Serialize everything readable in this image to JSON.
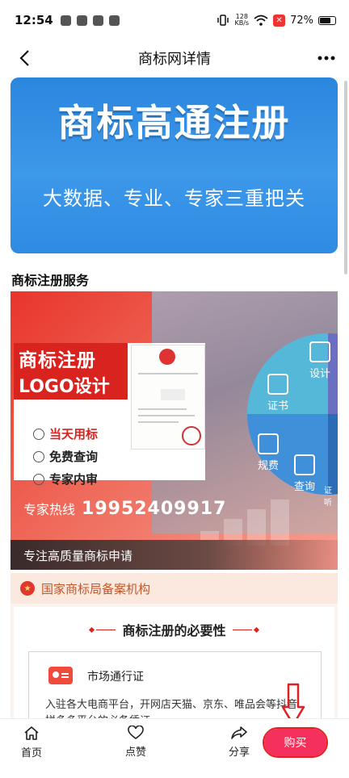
{
  "status_bar": {
    "time": "12:54",
    "speed_value": "128",
    "speed_unit": "KB/s",
    "battery": "72%"
  },
  "nav": {
    "title": "商标网详情"
  },
  "hero": {
    "title": "商标高通注册",
    "subtitle": "大数据、专业、专家三重把关"
  },
  "section_title": "商标注册服务",
  "promo": {
    "main_title": "商标注册",
    "logo_design": "LOGO设计",
    "features": [
      "当天用标",
      "免费查询",
      "专家内审"
    ],
    "pie_labels": [
      "设计",
      "证书",
      "规费",
      "查询",
      "证听"
    ],
    "hotline_label": "专家热线",
    "hotline_number": "19952409917",
    "band_text": "专注高质量商标申请"
  },
  "filing_notice": "国家商标局备案机构",
  "necessity": {
    "title": "商标注册的必要性",
    "item_title": "市场通行证",
    "item_desc": "入驻各大电商平台，开网店天猫、京东、唯品会等抖音、拼多多平台的必备凭证"
  },
  "tab_bar": {
    "home": "首页",
    "like": "点赞",
    "share": "分享",
    "buy": "购买"
  },
  "colors": {
    "brand_red": "#d8231e",
    "buy_button": "#f5305c",
    "hero_blue": "#2b86dd"
  }
}
